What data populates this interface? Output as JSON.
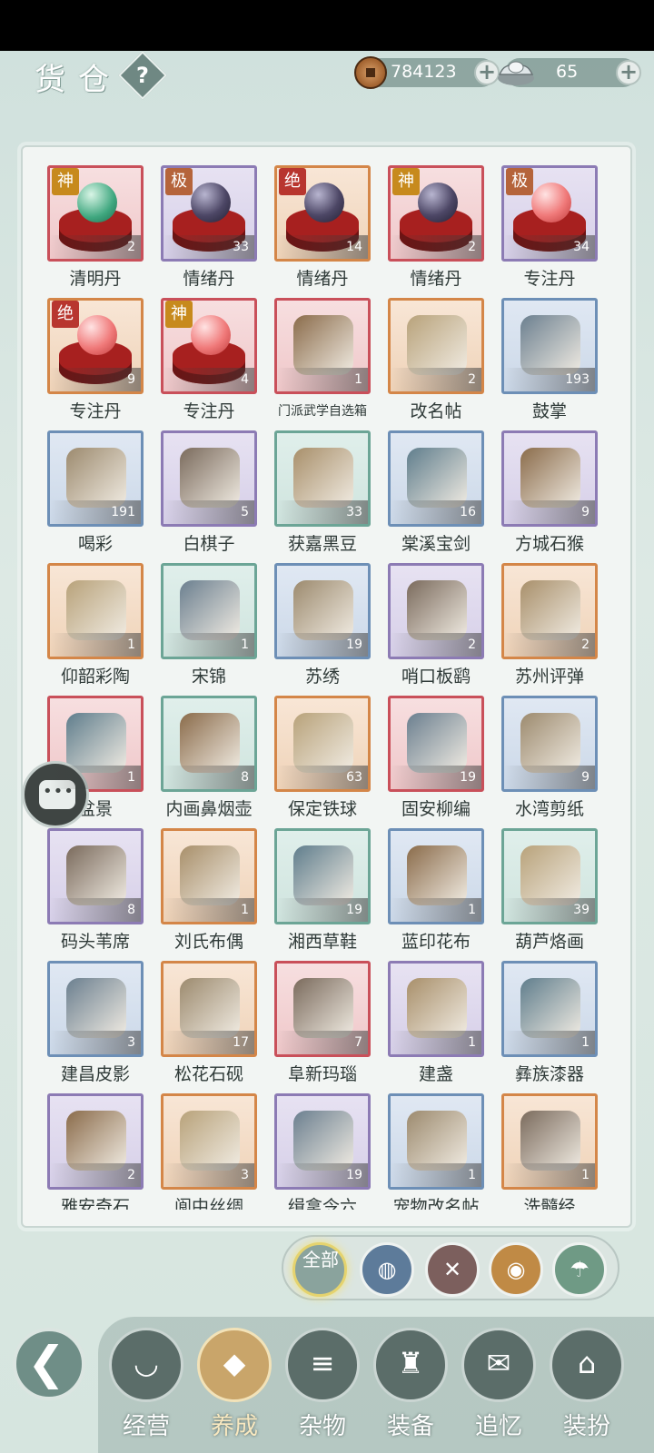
{
  "header": {
    "title": "货仓",
    "help_label": "?",
    "coins": "784123",
    "silver": "65",
    "plus": "+"
  },
  "items": [
    {
      "name": "清明丹",
      "count": "2",
      "badge": "神",
      "rarity": "red",
      "icon": "green-orb-icon"
    },
    {
      "name": "情绪丹",
      "count": "33",
      "badge": "极",
      "rarity": "purple",
      "icon": "dark-orb-icon"
    },
    {
      "name": "情绪丹",
      "count": "14",
      "badge": "绝",
      "rarity": "orange",
      "icon": "dark-orb-icon"
    },
    {
      "name": "情绪丹",
      "count": "2",
      "badge": "神",
      "rarity": "red",
      "icon": "dark-orb-icon"
    },
    {
      "name": "专注丹",
      "count": "34",
      "badge": "极",
      "rarity": "purple",
      "icon": "pink-orb-icon"
    },
    {
      "name": "专注丹",
      "count": "9",
      "badge": "绝",
      "rarity": "orange",
      "icon": "pink-orb-icon"
    },
    {
      "name": "专注丹",
      "count": "4",
      "badge": "神",
      "rarity": "red",
      "icon": "pink-orb-icon"
    },
    {
      "name": "门派武学自选箱",
      "count": "1",
      "badge": "",
      "rarity": "red",
      "icon": "cabinet-icon"
    },
    {
      "name": "改名帖",
      "count": "2",
      "badge": "",
      "rarity": "orange",
      "icon": "card-icon"
    },
    {
      "name": "鼓掌",
      "count": "193",
      "badge": "",
      "rarity": "blue",
      "icon": "clap-icon"
    },
    {
      "name": "喝彩",
      "count": "191",
      "badge": "",
      "rarity": "blue",
      "icon": "cheer-icon"
    },
    {
      "name": "白棋子",
      "count": "5",
      "badge": "",
      "rarity": "purple",
      "icon": "white-stone-icon"
    },
    {
      "name": "获嘉黑豆",
      "count": "33",
      "badge": "",
      "rarity": "green",
      "icon": "bean-jar-icon"
    },
    {
      "name": "棠溪宝剑",
      "count": "16",
      "badge": "",
      "rarity": "blue",
      "icon": "sword-icon"
    },
    {
      "name": "方城石猴",
      "count": "9",
      "badge": "",
      "rarity": "purple",
      "icon": "stone-monkey-icon"
    },
    {
      "name": "仰韶彩陶",
      "count": "1",
      "badge": "",
      "rarity": "orange",
      "icon": "pottery-icon"
    },
    {
      "name": "宋锦",
      "count": "1",
      "badge": "",
      "rarity": "green",
      "icon": "brocade-icon"
    },
    {
      "name": "苏绣",
      "count": "19",
      "badge": "",
      "rarity": "blue",
      "icon": "embroidery-icon"
    },
    {
      "name": "哨口板鹞",
      "count": "2",
      "badge": "",
      "rarity": "purple",
      "icon": "kite-icon"
    },
    {
      "name": "苏州评弹",
      "count": "2",
      "badge": "",
      "rarity": "orange",
      "icon": "book-icon"
    },
    {
      "name": "盆景",
      "count": "1",
      "badge": "",
      "rarity": "red",
      "icon": "bonsai-icon"
    },
    {
      "name": "内画鼻烟壶",
      "count": "8",
      "badge": "",
      "rarity": "green",
      "icon": "snuff-bottle-icon"
    },
    {
      "name": "保定铁球",
      "count": "63",
      "badge": "",
      "rarity": "orange",
      "icon": "iron-balls-icon"
    },
    {
      "name": "固安柳编",
      "count": "19",
      "badge": "",
      "rarity": "red",
      "icon": "basket-icon"
    },
    {
      "name": "水湾剪纸",
      "count": "9",
      "badge": "",
      "rarity": "blue",
      "icon": "paper-cut-icon"
    },
    {
      "name": "码头苇席",
      "count": "8",
      "badge": "",
      "rarity": "purple",
      "icon": "mat-icon"
    },
    {
      "name": "刘氏布偶",
      "count": "1",
      "badge": "",
      "rarity": "orange",
      "icon": "cloth-doll-icon"
    },
    {
      "name": "湘西草鞋",
      "count": "19",
      "badge": "",
      "rarity": "green",
      "icon": "straw-shoes-icon"
    },
    {
      "name": "蓝印花布",
      "count": "1",
      "badge": "",
      "rarity": "blue",
      "icon": "blue-cloth-icon"
    },
    {
      "name": "葫芦烙画",
      "count": "39",
      "badge": "",
      "rarity": "green",
      "icon": "gourd-icon"
    },
    {
      "name": "建昌皮影",
      "count": "3",
      "badge": "",
      "rarity": "blue",
      "icon": "shadow-puppet-icon"
    },
    {
      "name": "松花石砚",
      "count": "17",
      "badge": "",
      "rarity": "orange",
      "icon": "inkstone-icon"
    },
    {
      "name": "阜新玛瑙",
      "count": "7",
      "badge": "",
      "rarity": "red",
      "icon": "agate-icon"
    },
    {
      "name": "建盏",
      "count": "1",
      "badge": "",
      "rarity": "purple",
      "icon": "tea-bowl-icon"
    },
    {
      "name": "彝族漆器",
      "count": "1",
      "badge": "",
      "rarity": "blue",
      "icon": "lacquer-bowl-icon"
    },
    {
      "name": "雅安奇石",
      "count": "2",
      "badge": "",
      "rarity": "purple",
      "icon": "crystal-icon"
    },
    {
      "name": "阆中丝绸",
      "count": "3",
      "badge": "",
      "rarity": "orange",
      "icon": "silk-icon"
    },
    {
      "name": "缉拿令六",
      "count": "19",
      "badge": "",
      "rarity": "purple",
      "icon": "token-icon"
    },
    {
      "name": "宠物改名帖",
      "count": "1",
      "badge": "",
      "rarity": "blue",
      "icon": "pet-card-icon"
    },
    {
      "name": "洗髓经",
      "count": "1",
      "badge": "",
      "rarity": "orange",
      "icon": "manual-icon"
    }
  ],
  "filters": {
    "all_label": "全部",
    "items": [
      {
        "name": "bag-icon",
        "glyph": "◍"
      },
      {
        "name": "swords-icon",
        "glyph": "✕"
      },
      {
        "name": "scroll-icon",
        "glyph": "◉"
      },
      {
        "name": "umbrella-icon",
        "glyph": "☂"
      }
    ]
  },
  "nav": [
    {
      "label": "经营",
      "icon": "bowl-icon",
      "glyph": "◡",
      "active": false
    },
    {
      "label": "养成",
      "icon": "orb-stand-icon",
      "glyph": "◆",
      "active": true
    },
    {
      "label": "杂物",
      "icon": "bundle-icon",
      "glyph": "≡",
      "active": false
    },
    {
      "label": "装备",
      "icon": "robe-icon",
      "glyph": "♜",
      "active": false
    },
    {
      "label": "追忆",
      "icon": "letter-icon",
      "glyph": "✉",
      "active": false
    },
    {
      "label": "装扮",
      "icon": "pavilion-icon",
      "glyph": "⌂",
      "active": false
    }
  ],
  "colors": {
    "red": "#c9505a",
    "purple": "#8c7bb4",
    "orange": "#d48648",
    "blue": "#6d8fb6",
    "green": "#6ca596",
    "active_nav": "#c9a56a"
  }
}
